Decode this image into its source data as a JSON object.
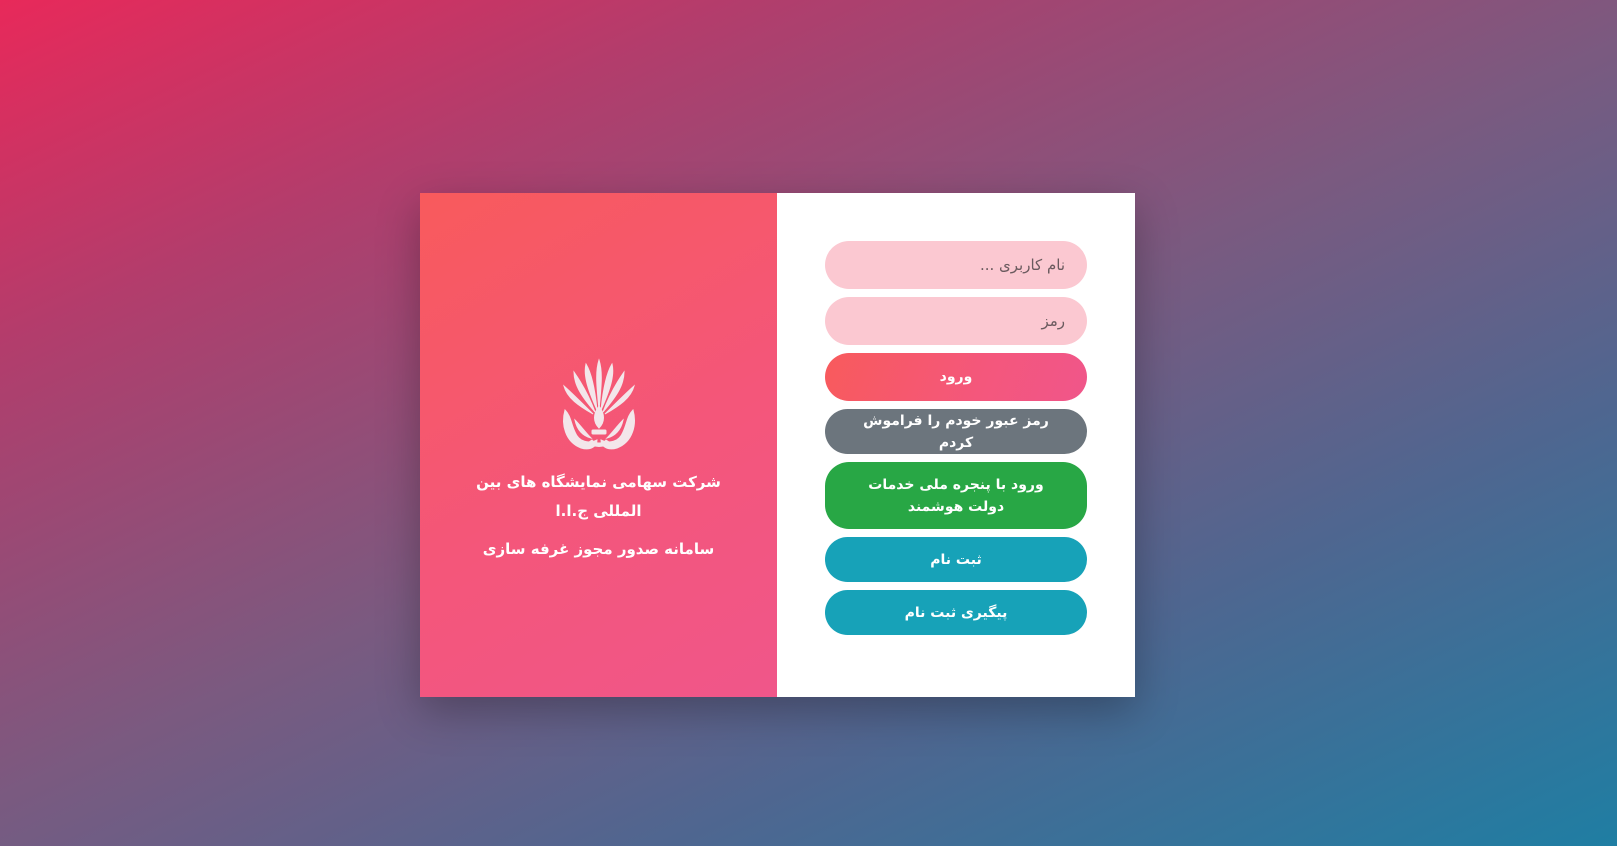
{
  "brand": {
    "logo_icon": "ifexco-flower-logo-icon",
    "company_name": "شرکت سهامی نمایشگاه های بین المللی ج.ا.ا",
    "system_name": "سامانه صدور مجوز غرفه سازی"
  },
  "login_form": {
    "username_placeholder": "نام کاربری ...",
    "password_placeholder": "رمز",
    "login_label": "ورود",
    "forgot_label": "رمز عبور خودم را فراموش کردم",
    "gov_login_label": "ورود با پنجره ملی خدمات دولت هوشمند",
    "register_label": "ثبت نام",
    "track_label": "پیگیری ثبت نام"
  },
  "colors": {
    "brand_gradient_start": "#f85a5c",
    "brand_gradient_end": "#f0568a",
    "field_bg": "#fbc8d1",
    "forgot_btn": "#6c757d",
    "gov_btn": "#28a745",
    "info_btn": "#17a2b8"
  }
}
